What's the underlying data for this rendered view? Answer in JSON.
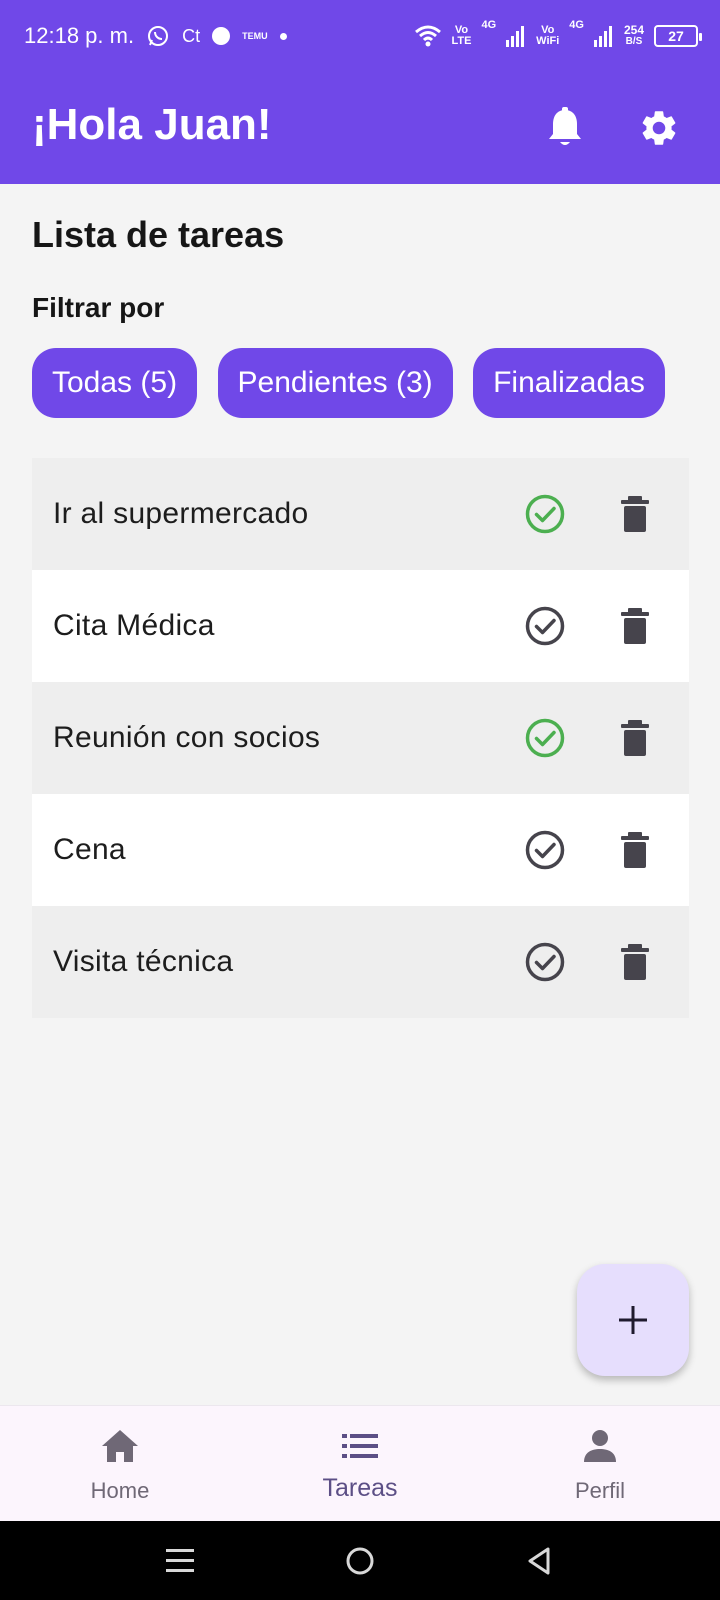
{
  "status_bar": {
    "time": "12:18 p. m.",
    "carrier_tag": "Ct",
    "temu_tag": "TEMU",
    "volte1_top": "Vo",
    "volte1_bottom": "LTE",
    "net1": "4G",
    "vowifi_top": "Vo",
    "vowifi_bottom": "WiFi",
    "net2": "4G",
    "speed_top": "254",
    "speed_bottom": "B/S",
    "battery": "27"
  },
  "header": {
    "greeting": "¡Hola Juan!"
  },
  "main": {
    "title": "Lista de tareas",
    "filter_label": "Filtrar por",
    "filters": [
      {
        "label": "Todas (5)"
      },
      {
        "label": "Pendientes (3)"
      },
      {
        "label": "Finalizadas"
      }
    ],
    "tasks": [
      {
        "title": "Ir al supermercado",
        "done": true
      },
      {
        "title": "Cita Médica",
        "done": false
      },
      {
        "title": "Reunión con socios",
        "done": true
      },
      {
        "title": "Cena",
        "done": false
      },
      {
        "title": "Visita técnica",
        "done": false
      }
    ]
  },
  "bottom_nav": {
    "items": [
      {
        "label": "Home",
        "icon": "home-icon",
        "active": false
      },
      {
        "label": "Tareas",
        "icon": "list-icon",
        "active": true
      },
      {
        "label": "Perfil",
        "icon": "person-icon",
        "active": false
      }
    ]
  },
  "colors": {
    "primary": "#7048e8",
    "done_green": "#4caf50",
    "pending_gray": "#46444c",
    "fab_bg": "#e6defd"
  }
}
